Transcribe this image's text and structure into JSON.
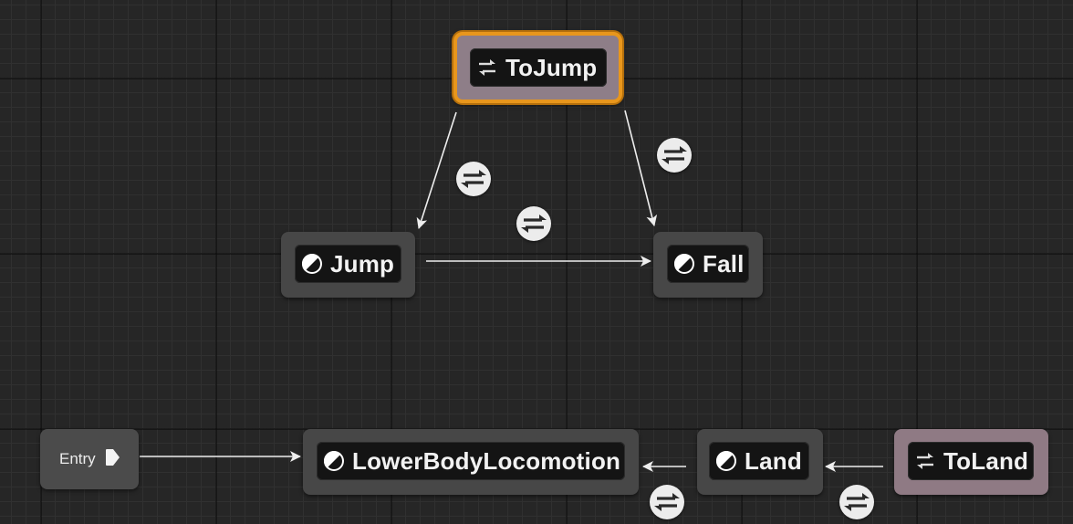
{
  "graph": {
    "entry": {
      "label": "Entry"
    },
    "states": [
      {
        "id": "tojump",
        "label": "ToJump",
        "kind": "conduit",
        "selected": true
      },
      {
        "id": "jump",
        "label": "Jump",
        "kind": "state"
      },
      {
        "id": "fall",
        "label": "Fall",
        "kind": "state"
      },
      {
        "id": "lowerbody",
        "label": "LowerBodyLocomotion",
        "kind": "state"
      },
      {
        "id": "land",
        "label": "Land",
        "kind": "state"
      },
      {
        "id": "toland",
        "label": "ToLand",
        "kind": "conduit"
      }
    ],
    "transitions": [
      {
        "from": "ToJump",
        "to": "Jump",
        "rule_icon": "transition-rule-icon"
      },
      {
        "from": "ToJump",
        "to": "Fall",
        "rule_icon": "transition-rule-icon"
      },
      {
        "from": "Jump",
        "to": "Fall",
        "rule_icon": "transition-rule-icon"
      },
      {
        "from": "Entry",
        "to": "LowerBodyLocomotion"
      },
      {
        "from": "Land",
        "to": "LowerBodyLocomotion",
        "rule_icon": "transition-rule-icon"
      },
      {
        "from": "ToLand",
        "to": "Land",
        "rule_icon": "transition-rule-icon"
      }
    ]
  },
  "colors": {
    "background": "#262626",
    "selection_outline": "#e8961c",
    "conduit": "#8f7a84",
    "state": "#474747",
    "wire": "#eeeeee"
  },
  "icons": {
    "state": "state-half-circle-icon",
    "conduit": "conduit-swap-arrows-icon",
    "entry": "entry-pin-icon",
    "rule": "transition-rule-icon"
  }
}
